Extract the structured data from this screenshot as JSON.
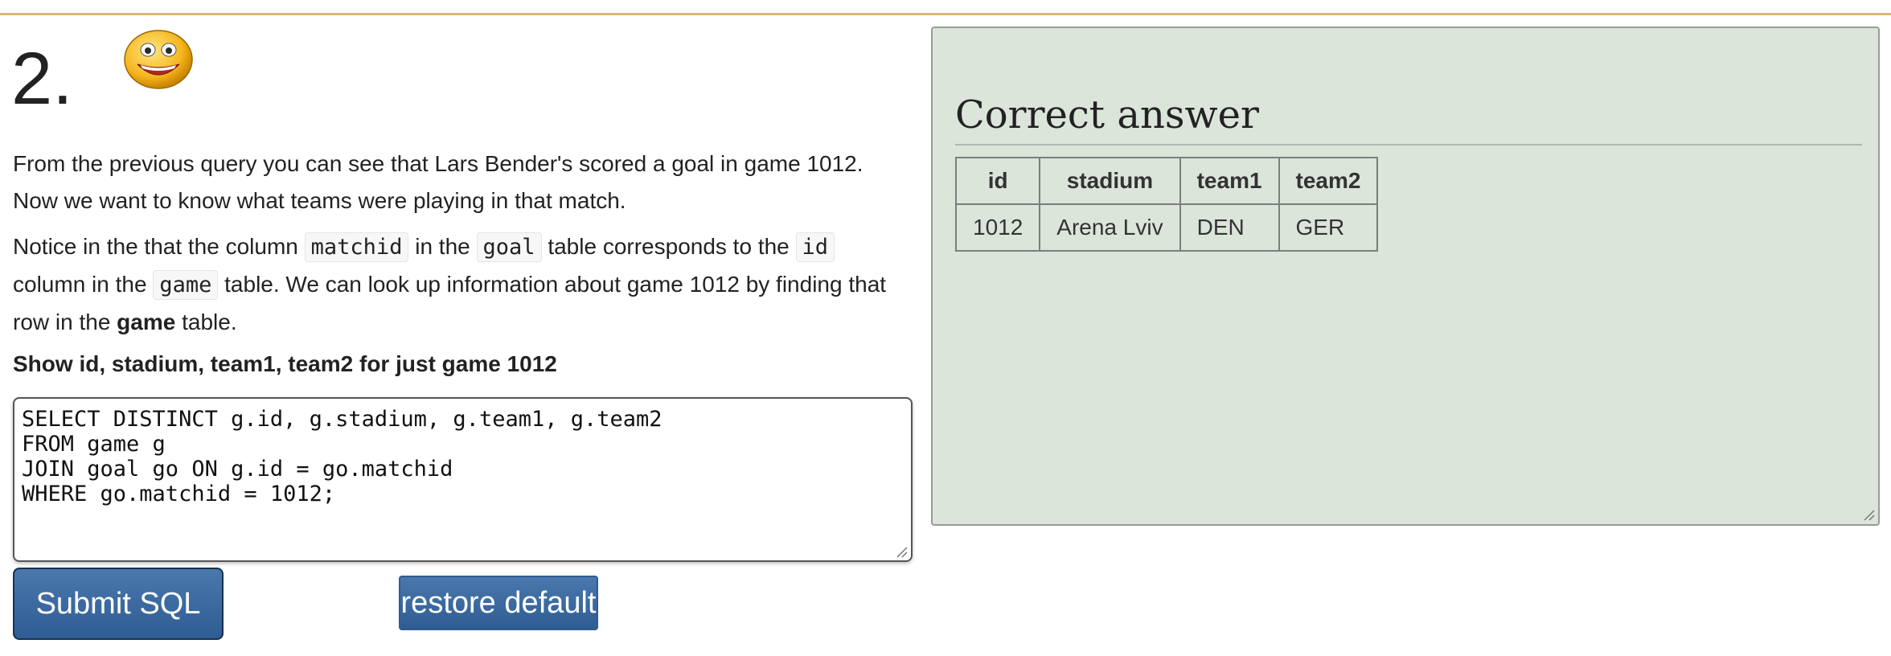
{
  "question": {
    "number": "2.",
    "emoji": "smiley-face-icon"
  },
  "intro": {
    "line1": "From the previous query you can see that Lars Bender's scored a goal in game 1012.",
    "line2": "Now we want to know what teams were playing in that match."
  },
  "notice": {
    "t1": "Notice in the that the column ",
    "c1": "matchid",
    "t2": " in the ",
    "c2": "goal",
    "t3": " table corresponds to the ",
    "c3": "id",
    "t4": "column in the ",
    "c4": "game",
    "t5": " table. We can look up information about game 1012 by finding that",
    "t6": "row in the ",
    "bold": "game",
    "t7": " table."
  },
  "task": "Show id, stadium, team1, team2 for just game 1012",
  "editor": {
    "value": "SELECT DISTINCT g.id, g.stadium, g.team1, g.team2\nFROM game g\nJOIN goal go ON g.id = go.matchid\nWHERE go.matchid = 1012;"
  },
  "buttons": {
    "submit": "Submit SQL",
    "restore": "restore default"
  },
  "answer": {
    "heading": "Correct answer",
    "columns": [
      "id",
      "stadium",
      "team1",
      "team2"
    ],
    "rows": [
      [
        "1012",
        "Arena Lviv",
        "DEN",
        "GER"
      ]
    ]
  },
  "colors": {
    "accent_rule": "#d4b97a",
    "panel_bg": "#dbe5da",
    "button": "#2f5d93"
  }
}
